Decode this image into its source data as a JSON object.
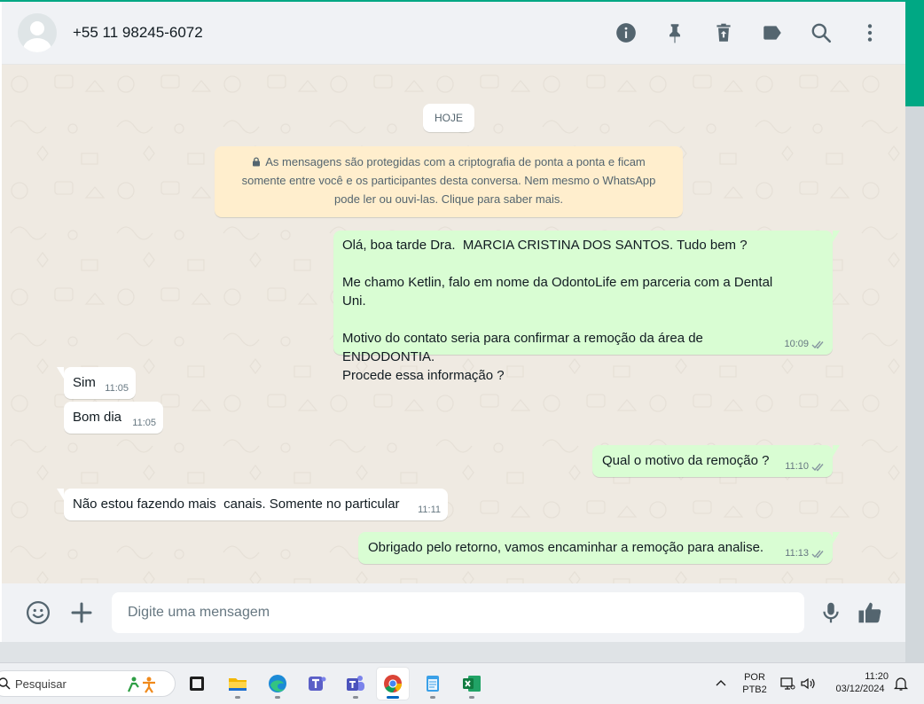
{
  "header": {
    "contact_name": "+55 11 98245-6072",
    "icons": [
      "info-icon",
      "pin-icon",
      "delete-icon",
      "label-icon",
      "search-icon",
      "menu-icon"
    ]
  },
  "chat": {
    "date_chip": "HOJE",
    "encryption_notice": {
      "line1": "As mensagens são protegidas com a criptografia de ponta a ponta e ficam",
      "line2": "somente entre você e os participantes desta conversa. Nem mesmo o WhatsApp",
      "line3": "pode ler ou ouvi-las. Clique para saber mais."
    },
    "messages": [
      {
        "direction": "out",
        "text": "Olá, boa tarde Dra.  MARCIA CRISTINA DOS SANTOS. Tudo bem ?\n\nMe chamo Ketlin, falo em nome da OdontoLife em parceria com a Dental Uni.\n\nMotivo do contato seria para confirmar a remoção da área de ENDODONTIA.\nProcede essa informação ?",
        "time": "10:09"
      },
      {
        "direction": "in",
        "text": "Sim",
        "time": "11:05"
      },
      {
        "direction": "in",
        "text": "Bom dia",
        "time": "11:05"
      },
      {
        "direction": "out",
        "text": "Qual o motivo da remoção ?",
        "time": "11:10"
      },
      {
        "direction": "in",
        "text": "Não estou fazendo mais  canais. Somente no particular",
        "time": "11:11"
      },
      {
        "direction": "out",
        "text": "Obrigado pelo retorno, vamos encaminhar a remoção para analise.",
        "time": "11:13"
      }
    ]
  },
  "composer": {
    "placeholder": "Digite uma mensagem",
    "value": ""
  },
  "taskbar": {
    "search_label": "Pesquisar",
    "apps": [
      "task-view",
      "file-explorer",
      "edge",
      "teams",
      "teams-classic",
      "chrome",
      "notepad",
      "excel"
    ],
    "active_app": "chrome",
    "language": "POR",
    "keyboard": "PTB2",
    "time": "11:20",
    "date": "03/12/2024"
  },
  "colors": {
    "accent": "#00a884",
    "outgoing_bubble": "#d9fdd3",
    "incoming_bubble": "#ffffff",
    "chat_background": "#efeae2",
    "encryption_notice": "#ffeecd",
    "read_ticks": "#8696a0"
  }
}
